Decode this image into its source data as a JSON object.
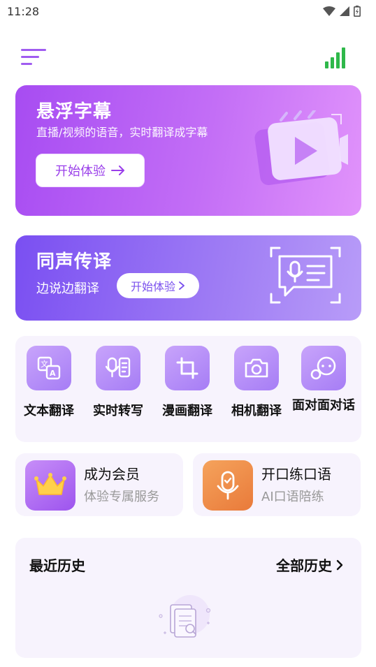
{
  "status_bar": {
    "time": "11:28"
  },
  "colors": {
    "accent_purple": "#a74cf2",
    "accent_violet": "#7a4ff2",
    "signal_green": "#2fb84a",
    "card_bg": "#f7f3fd"
  },
  "header": {
    "menu_icon": "menu-icon",
    "signal_icon": "signal-bars-icon"
  },
  "floating_subtitles": {
    "title": "悬浮字幕",
    "subtitle": "直播/视频的语音，实时翻译成字幕",
    "cta": "开始体验"
  },
  "simultaneous": {
    "title": "同声传译",
    "subtitle": "边说边翻译",
    "cta": "开始体验"
  },
  "tools": [
    {
      "label": "文本翻译",
      "icon": "text-translate-icon"
    },
    {
      "label": "实时转写",
      "icon": "mic-transcribe-icon"
    },
    {
      "label": "漫画翻译",
      "icon": "crop-icon"
    },
    {
      "label": "相机翻译",
      "icon": "camera-icon"
    },
    {
      "label": "面对面对话",
      "icon": "chat-bubbles-icon"
    }
  ],
  "promos": [
    {
      "title": "成为会员",
      "subtitle": "体验专属服务",
      "icon": "crown-icon"
    },
    {
      "title": "开口练口语",
      "subtitle": "AI口语陪练",
      "icon": "mic-check-icon"
    }
  ],
  "history": {
    "title": "最近历史",
    "all_label": "全部历史"
  }
}
